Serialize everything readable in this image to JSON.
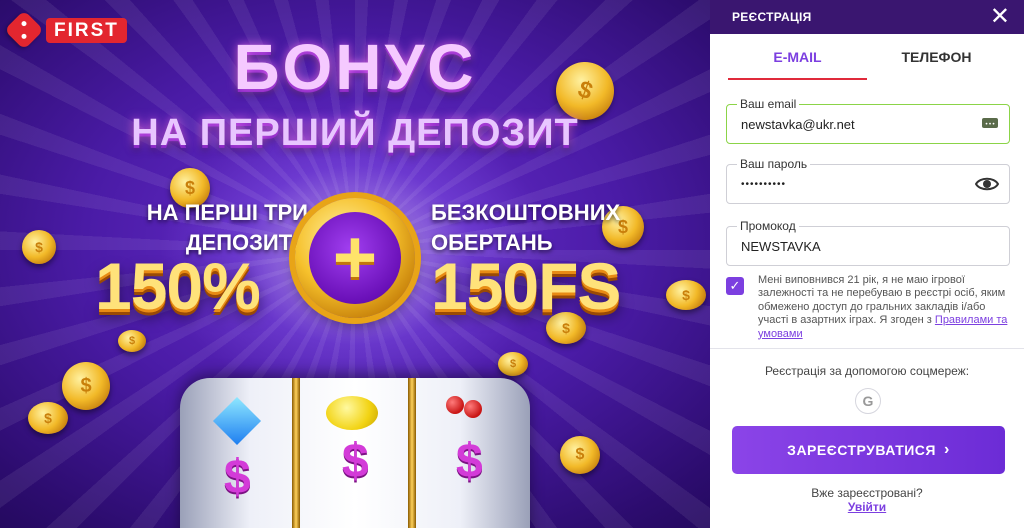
{
  "brand": {
    "logo_text": "FIRST"
  },
  "promo": {
    "headline_1": "БОНУС",
    "headline_2": "НА ПЕРШИЙ ДЕПОЗИТ",
    "left_text_1": "НА ПЕРШІ ТРИ",
    "left_text_2": "ДЕПОЗИТИ",
    "right_text_1": "БЕЗКОШТОВНИХ",
    "right_text_2": "ОБЕРТАНЬ",
    "left_big": "150%",
    "right_big": "150FS",
    "plus": "+"
  },
  "panel": {
    "title": "РЕЄСТРАЦІЯ",
    "close_icon": "close-icon",
    "tabs": [
      {
        "label": "E-MAIL",
        "active": true
      },
      {
        "label": "ТЕЛЕФОН",
        "active": false
      }
    ],
    "email": {
      "label": "Ваш email",
      "value": "newstavka@ukr.net"
    },
    "password": {
      "label": "Ваш пароль",
      "value": "••••••••••"
    },
    "promo_code": {
      "label": "Промокод",
      "value": "NEWSTAVKA"
    },
    "agreement": {
      "checked": true,
      "text": "Мені виповнився 21 рік, я не маю ігрової залежності та не перебуваю в реєстрі осіб, яким обмежено доступ до гральних закладів і/або участі в азартних іграх. Я згоден з ",
      "link": "Правилами та умовами"
    },
    "social_label": "Реєстрація за допомогою соцмереж:",
    "google_letter": "G",
    "submit_label": "ЗАРЕЄСТРУВАТИСЯ",
    "submit_chevron": "›",
    "already_label": "Вже зареєстровані?",
    "login_link": "Увійти"
  },
  "colors": {
    "accent": "#7c3fe0",
    "header": "#3a1670",
    "tab_underline": "#e02a3b",
    "valid_border": "#8bd447",
    "brand_red": "#e3262f"
  }
}
